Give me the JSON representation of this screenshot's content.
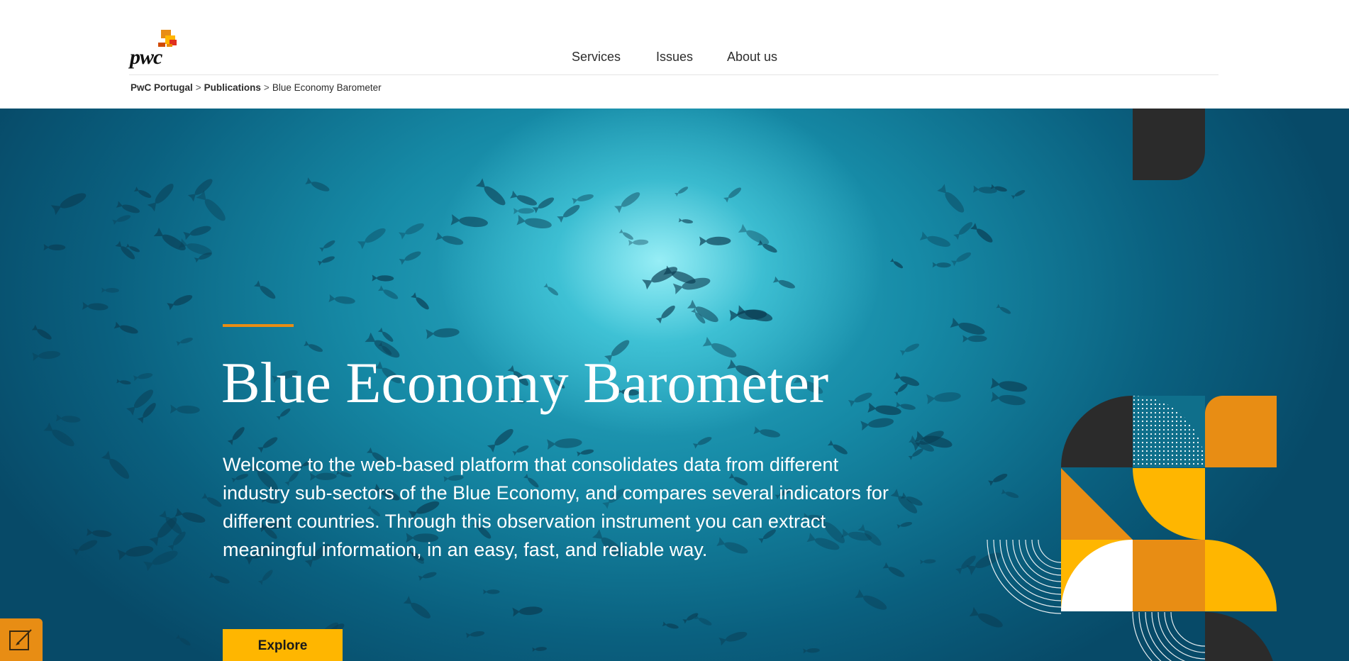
{
  "brand": {
    "logo_text": "pwc"
  },
  "nav": {
    "items": [
      {
        "label": "Services"
      },
      {
        "label": "Issues"
      },
      {
        "label": "About us"
      }
    ]
  },
  "breadcrumb": {
    "items": [
      "PwC Portugal",
      "Publications"
    ],
    "separator": ">",
    "current": "Blue Economy Barometer"
  },
  "hero": {
    "title": "Blue Economy Barometer",
    "description": "Welcome to the web-based platform that consolidates data from different industry sub-sectors of the Blue Economy, and compares several indicators for different countries. Through this observation instrument you can extract meaningful information, in an easy, fast, and reliable way.",
    "cta_label": "Explore"
  },
  "icons": {
    "feedback": "edit-note-icon"
  },
  "colors": {
    "accent_orange": "#e88d14",
    "accent_yellow": "#ffb600",
    "dark": "#2d2d2d",
    "ocean": "#0a607f"
  }
}
